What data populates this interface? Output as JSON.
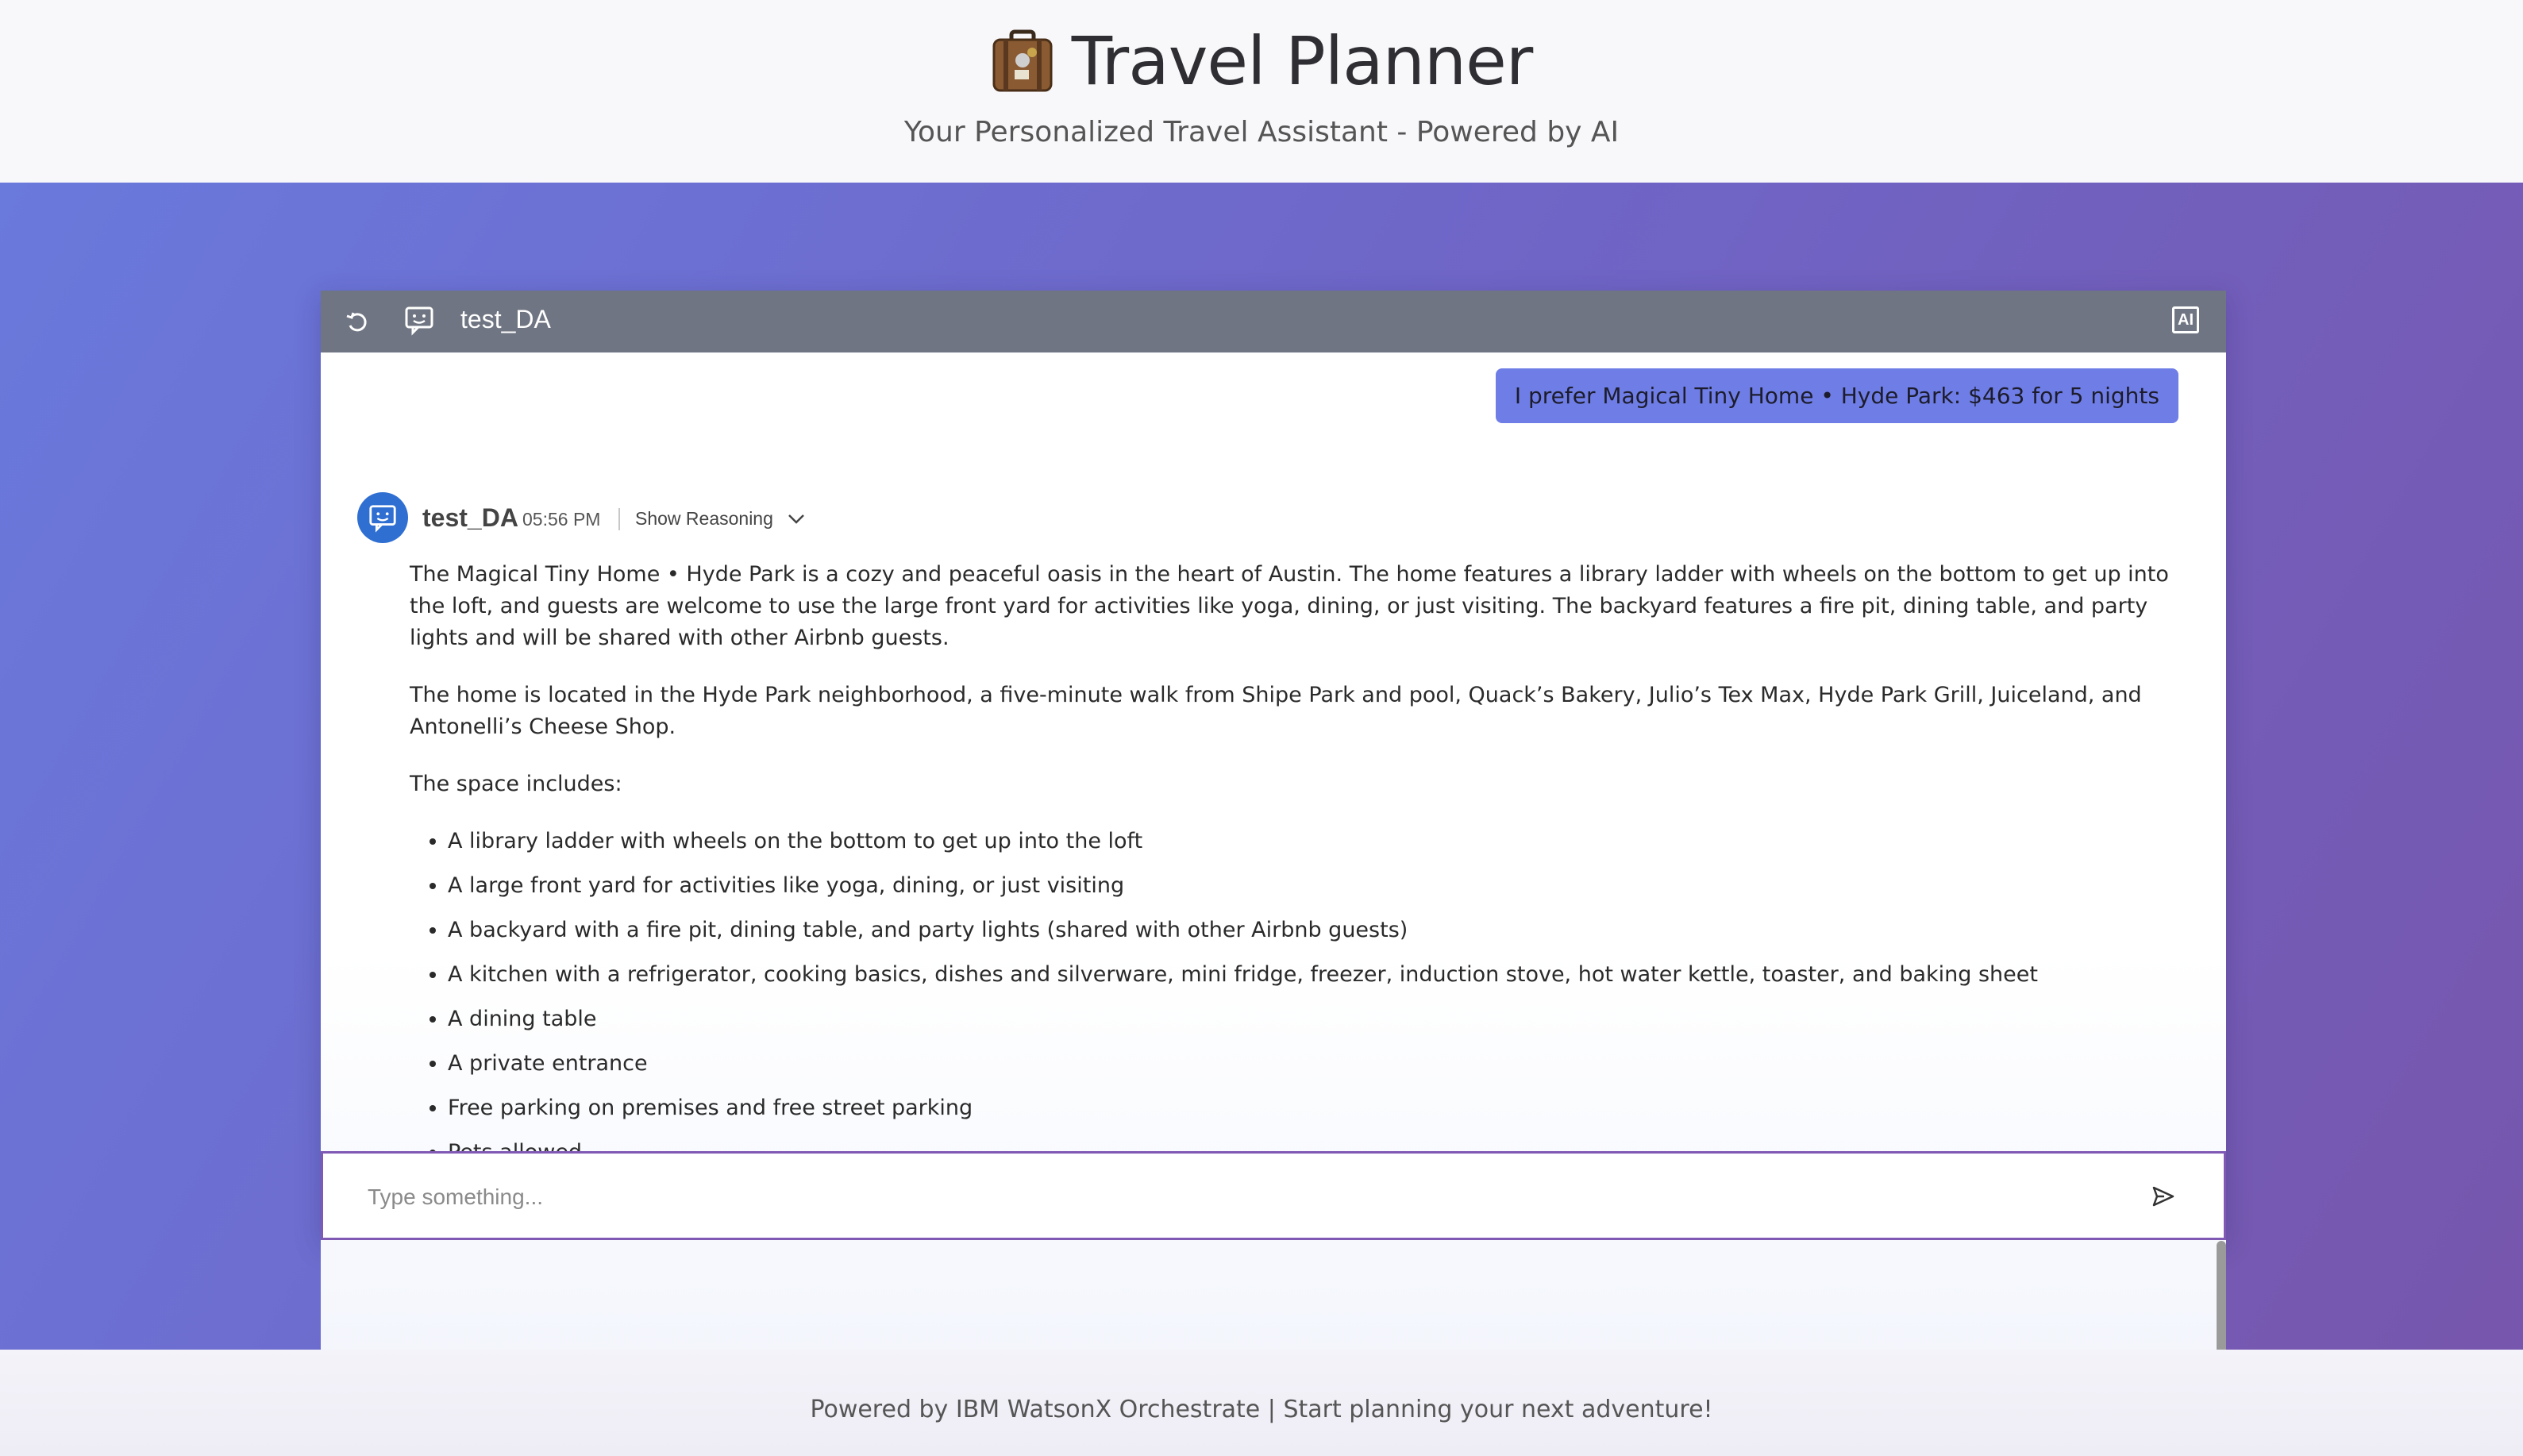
{
  "header": {
    "title": "Travel Planner",
    "subtitle": "Your Personalized Travel Assistant - Powered by AI"
  },
  "chat": {
    "agent_name": "test_DA",
    "ai_badge": "AI",
    "user_message": "I prefer Magical Tiny Home • Hyde Park: $463 for 5 nights",
    "bot": {
      "name": "test_DA",
      "time": "05:56 PM",
      "show_reasoning": "Show Reasoning",
      "paragraphs": [
        "The Magical Tiny Home • Hyde Park is a cozy and peaceful oasis in the heart of Austin. The home features a library ladder with wheels on the bottom to get up into the loft, and guests are welcome to use the large front yard for activities like yoga, dining, or just visiting. The backyard features a fire pit, dining table, and party lights and will be shared with other Airbnb guests.",
        "The home is located in the Hyde Park neighborhood, a five-minute walk from Shipe Park and pool, Quack’s Bakery, Julio’s Tex Max, Hyde Park Grill, Juiceland, and Antonelli’s Cheese Shop.",
        "The space includes:"
      ],
      "list": [
        "A library ladder with wheels on the bottom to get up into the loft",
        "A large front yard for activities like yoga, dining, or just visiting",
        "A backyard with a fire pit, dining table, and party lights (shared with other Airbnb guests)",
        "A kitchen with a refrigerator, cooking basics, dishes and silverware, mini fridge, freezer, induction stove, hot water kettle, toaster, and baking sheet",
        "A dining table",
        "A private entrance",
        "Free parking on premises and free street parking",
        "Pets allowed"
      ]
    },
    "input_placeholder": "Type something..."
  },
  "footer": {
    "text": "Powered by IBM WatsonX Orchestrate | Start planning your next adventure!"
  },
  "icons": {
    "suitcase": "suitcase-icon",
    "restart": "restart-icon",
    "agent": "chat-agent-icon",
    "chevron": "chevron-down-icon",
    "send": "send-icon"
  },
  "colors": {
    "hero_gradient_start": "#6a79dc",
    "hero_gradient_end": "#7756ad",
    "chat_header": "#6f7582",
    "user_bubble": "#6f7ee6",
    "bot_avatar": "#2f6fd1",
    "input_border": "#7f59b4"
  }
}
